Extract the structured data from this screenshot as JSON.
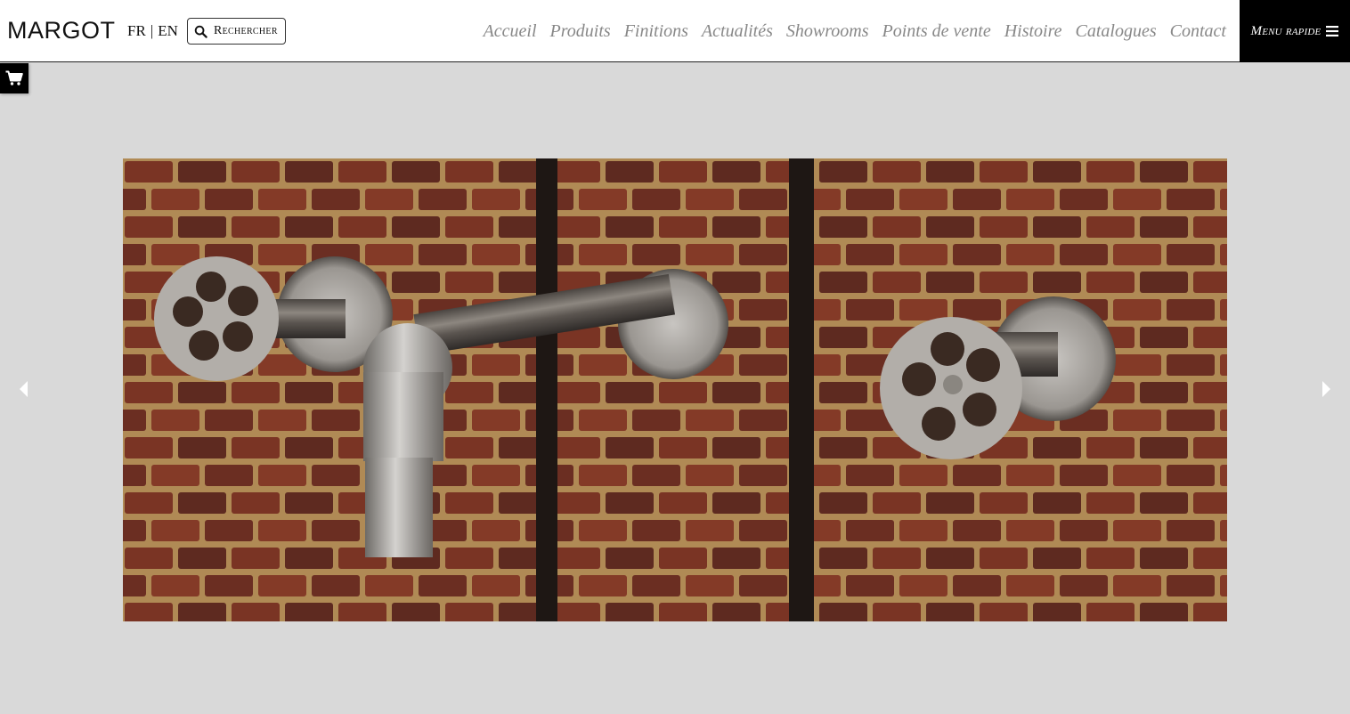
{
  "header": {
    "logo": "MARGOT",
    "lang": {
      "fr": "FR",
      "sep": "|",
      "en": "EN"
    },
    "search_label": "Rechercher",
    "nav": [
      "Accueil",
      "Produits",
      "Finitions",
      "Actualités",
      "Showrooms",
      "Points de vente",
      "Histoire",
      "Catalogues",
      "Contact"
    ],
    "quick_menu_label": "Menu rapide"
  },
  "icons": {
    "search": "search-icon",
    "menu": "hamburger-icon",
    "cart": "cart-icon",
    "prev": "arrow-left-icon",
    "next": "arrow-right-icon"
  },
  "colors": {
    "header_bg": "#ffffff",
    "page_bg": "#d9d9d9",
    "nav_text": "#888888",
    "quick_menu_bg": "#000000"
  }
}
